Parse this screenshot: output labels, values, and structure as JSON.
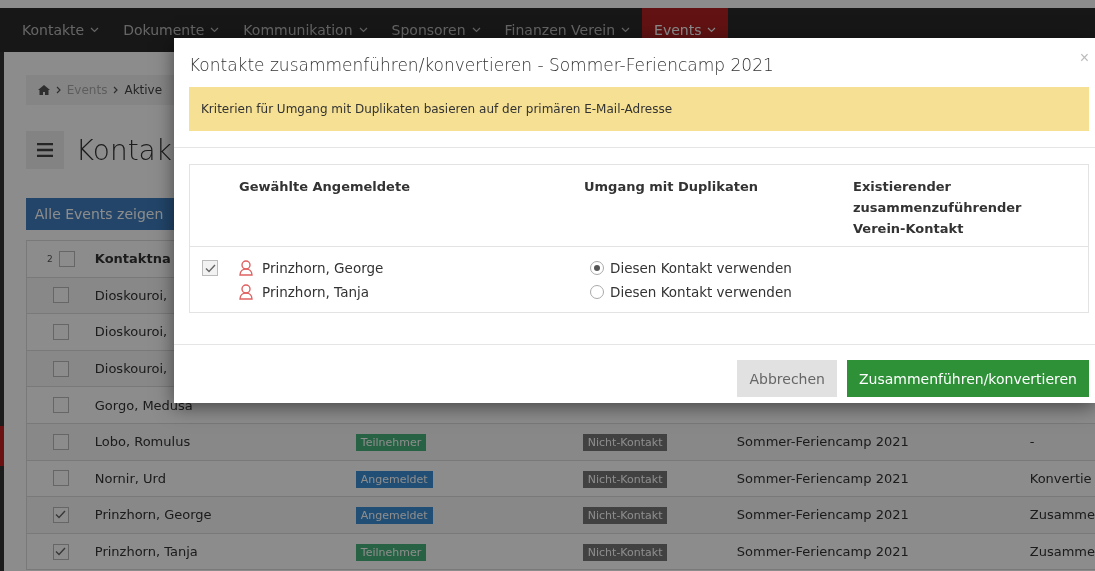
{
  "nav": [
    {
      "label": "Kontakte",
      "selected": false
    },
    {
      "label": "Dokumente",
      "selected": false
    },
    {
      "label": "Kommunikation",
      "selected": false
    },
    {
      "label": "Sponsoren",
      "selected": false
    },
    {
      "label": "Finanzen Verein",
      "selected": false
    },
    {
      "label": "Events",
      "selected": true
    }
  ],
  "breadcrumb": [
    "Events",
    "Aktive"
  ],
  "page_title": "Kontak",
  "show_all_button": "Alle Events zeigen",
  "table": {
    "selected_count": "2",
    "header_checked": false,
    "column_1": "Kontaktna",
    "rows": [
      {
        "name": "Dioskouroi,",
        "checked": false
      },
      {
        "name": "Dioskouroi,",
        "checked": false
      },
      {
        "name": "Dioskouroi,",
        "checked": false
      },
      {
        "name": "Gorgo, Medusa",
        "checked": false
      },
      {
        "name": "Lobo, Romulus",
        "checked": false,
        "status": {
          "label": "Teilnehmer",
          "kind": "participant"
        },
        "contact": "Nicht-Kontakt",
        "event": "Sommer-Feriencamp 2021",
        "column_5": "-"
      },
      {
        "name": "Nornir, Urd",
        "checked": false,
        "status": {
          "label": "Angemeldet",
          "kind": "registered"
        },
        "contact": "Nicht-Kontakt",
        "event": "Sommer-Feriencamp 2021",
        "column_5": "Konvertie"
      },
      {
        "name": "Prinzhorn, George",
        "checked": true,
        "status": {
          "label": "Angemeldet",
          "kind": "registered"
        },
        "contact": "Nicht-Kontakt",
        "event": "Sommer-Feriencamp 2021",
        "column_5": "Zusamme"
      },
      {
        "name": "Prinzhorn, Tanja",
        "checked": true,
        "status": {
          "label": "Teilnehmer",
          "kind": "participant"
        },
        "contact": "Nicht-Kontakt",
        "event": "Sommer-Feriencamp 2021",
        "column_5": "Zusamme"
      }
    ]
  },
  "modal": {
    "title": "Kontakte zusammenführen/konvertieren - Sommer-Feriencamp 2021",
    "close": "×",
    "alert": "Kriterien für Umgang mit Duplikaten basieren auf der primären E-Mail-Adresse",
    "columns": [
      "Gewählte Angemeldete",
      "Umgang mit Duplikaten",
      "Existierender zusammenzuführender Verein-Kontakt"
    ],
    "groups": [
      {
        "checked": true,
        "people": [
          {
            "name": "Prinzhorn, George",
            "option": "Diesen Kontakt verwenden",
            "selected": true
          },
          {
            "name": "Prinzhorn, Tanja",
            "option": "Diesen Kontakt verwenden",
            "selected": false
          }
        ]
      }
    ],
    "cancel": "Abbrechen",
    "submit": "Zusammenführen/konvertieren"
  }
}
